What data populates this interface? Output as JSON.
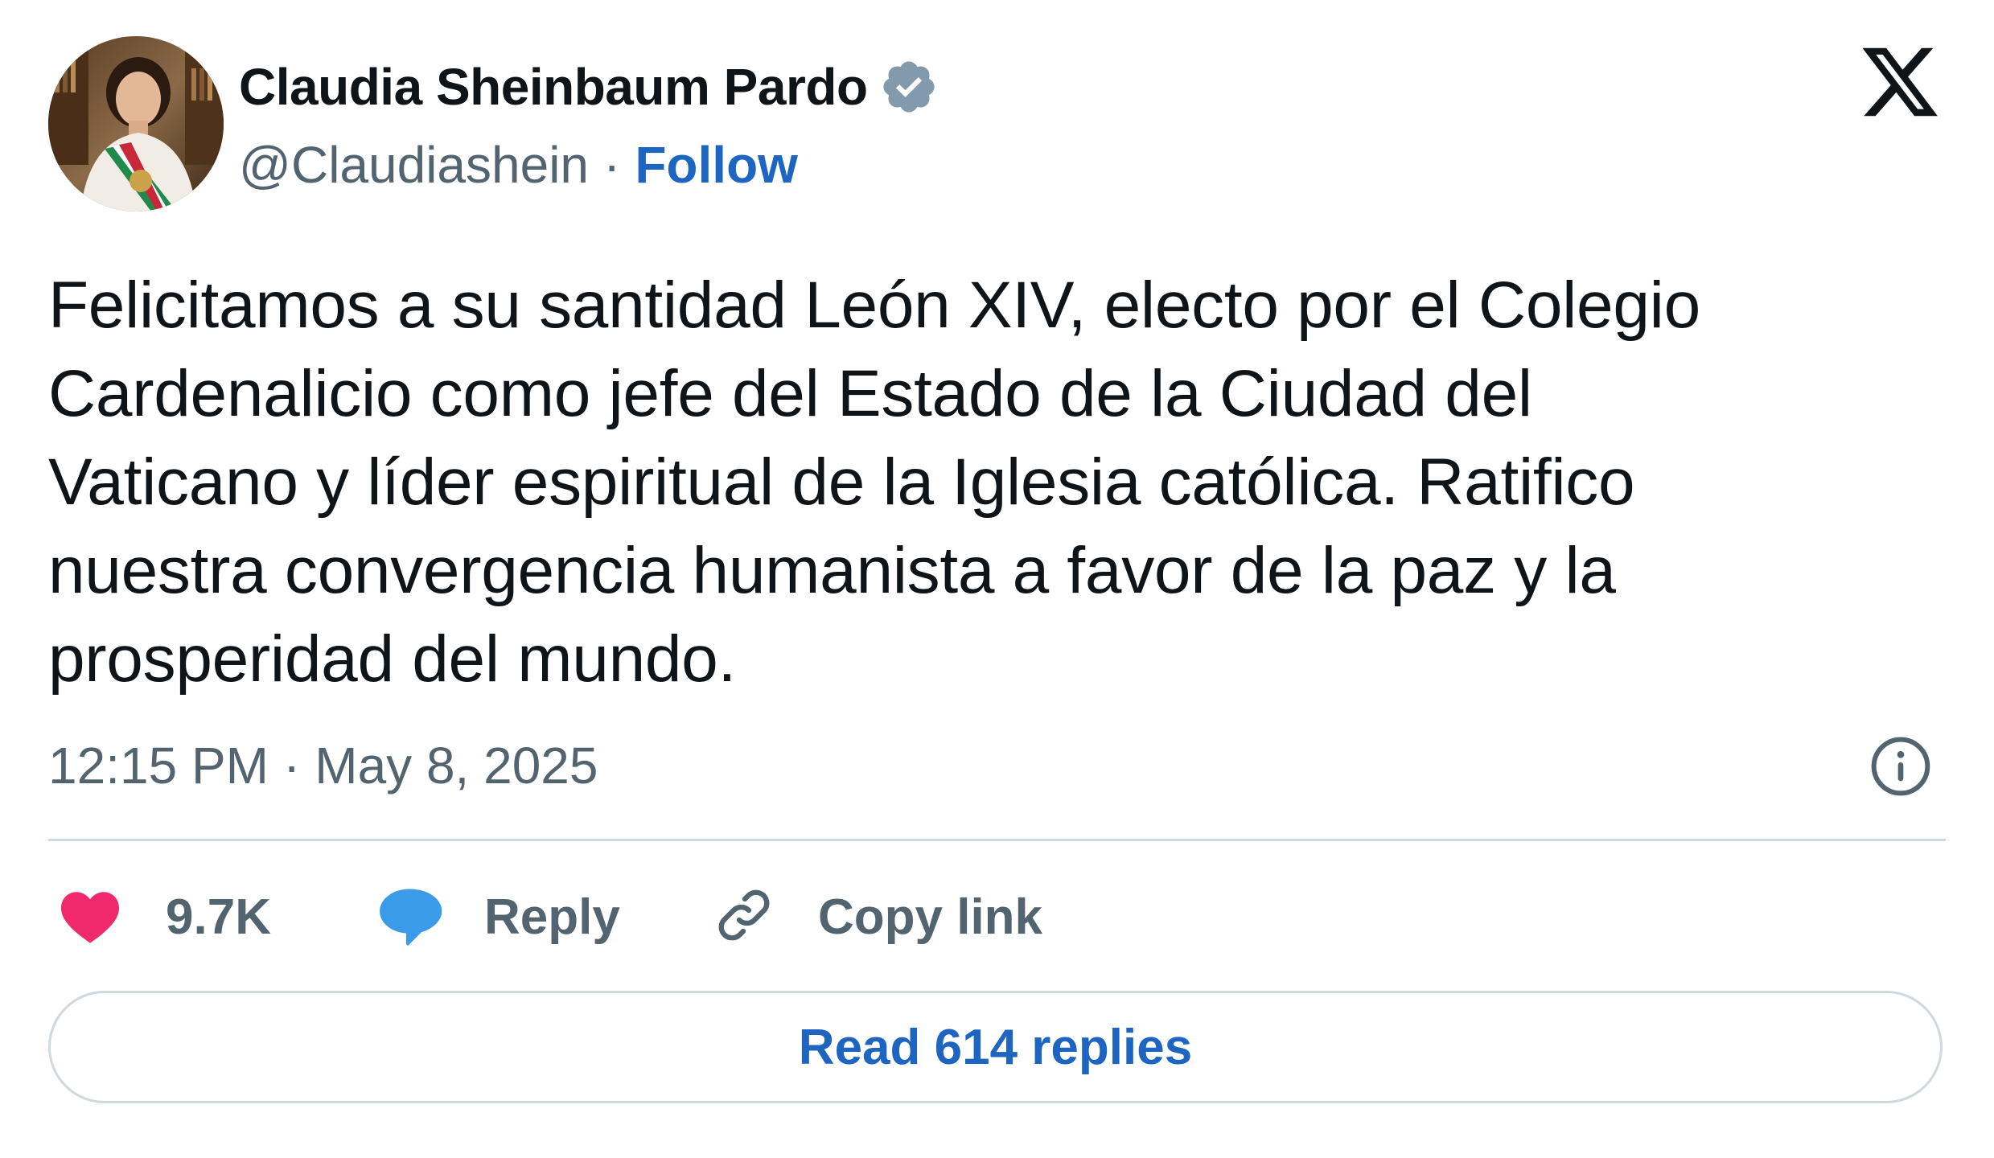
{
  "author": {
    "name": "Claudia Sheinbaum Pardo",
    "handle": "@Claudiashein",
    "separator": "·",
    "follow_label": "Follow",
    "verified": true
  },
  "brand": {
    "logo": "x-logo-icon"
  },
  "tweet": {
    "text": "Felicitamos a su santidad León XIV, electo por el Colegio\nCardenalicio como jefe del Estado de la Ciudad del\nVaticano y líder espiritual de la Iglesia católica. Ratifico\nnuestra convergencia humanista a favor de la paz y la\nprosperidad del mundo.",
    "time": "12:15 PM",
    "separator": "·",
    "date": "May 8, 2025"
  },
  "actions": {
    "like_count": "9.7K",
    "reply_label": "Reply",
    "copy_label": "Copy link"
  },
  "replies": {
    "label": "Read 614 replies"
  },
  "colors": {
    "text": "#0f1419",
    "secondary": "#536471",
    "link": "#1d65c1",
    "like": "#f0286c",
    "reply_bubble": "#3a9be8",
    "verified": "#829aab",
    "border": "#cfd9de"
  }
}
